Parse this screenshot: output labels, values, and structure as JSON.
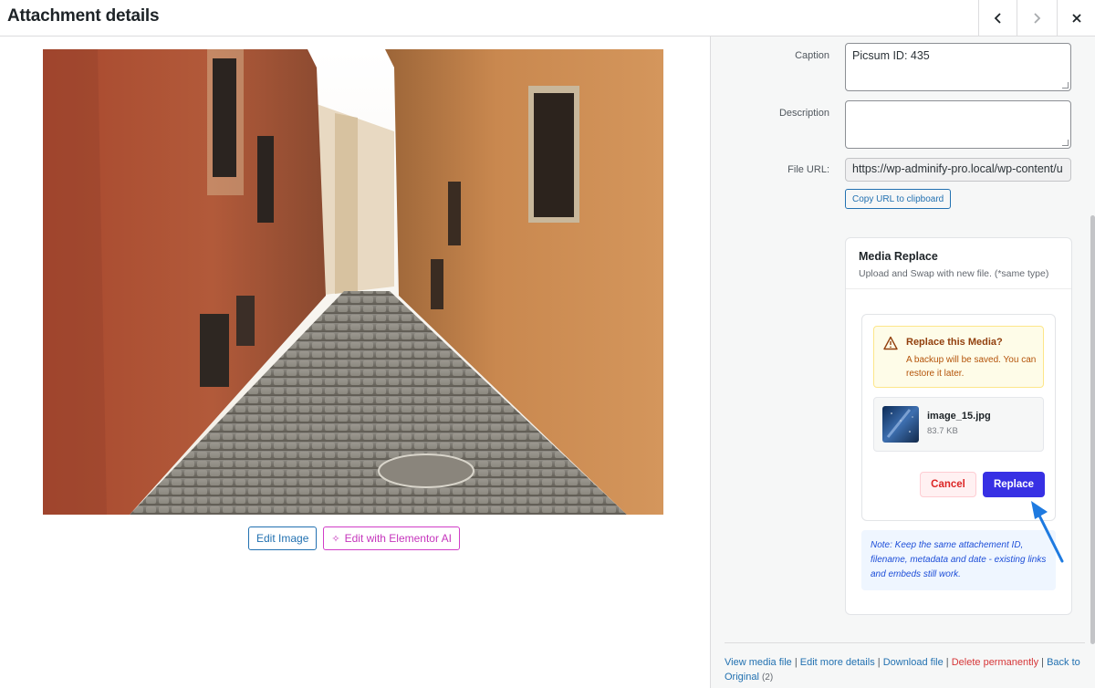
{
  "header": {
    "title": "Attachment details",
    "prev_icon": "chevron-left-icon",
    "next_icon": "chevron-right-icon",
    "close_icon": "close-icon"
  },
  "image_actions": {
    "edit_image": "Edit Image",
    "edit_ai": "Edit with Elementor AI",
    "ai_icon": "sparkle-icon"
  },
  "sidebar": {
    "caption_label": "Caption",
    "caption_value": "Picsum ID: 435",
    "description_label": "Description",
    "description_value": "",
    "file_url_label": "File URL:",
    "file_url_value": "https://wp-adminify-pro.local/wp-content/u",
    "copy_url": "Copy URL to clipboard"
  },
  "media_replace": {
    "title": "Media Replace",
    "subtitle": "Upload and Swap with new file. (*same type)",
    "warning_title": "Replace this Media?",
    "warning_text": "A backup will be saved. You can restore it later.",
    "warning_icon": "warning-triangle-icon",
    "file_name": "image_15.jpg",
    "file_size": "83.7 KB",
    "cancel": "Cancel",
    "replace": "Replace",
    "note": "Note: Keep the same attachement ID, filename, metadata and date - existing links and embeds still work."
  },
  "footer_links": {
    "view": "View media file",
    "edit_more": "Edit more details",
    "download": "Download file",
    "delete": "Delete permanently",
    "back": "Back to Original",
    "back_count": "(2)",
    "separator": "|"
  },
  "colors": {
    "accent": "#2271b1",
    "replace_button": "#3730e4",
    "delete_link": "#d63638",
    "ai_button": "#c636bd",
    "pointer_arrow": "#1e7ae0"
  }
}
